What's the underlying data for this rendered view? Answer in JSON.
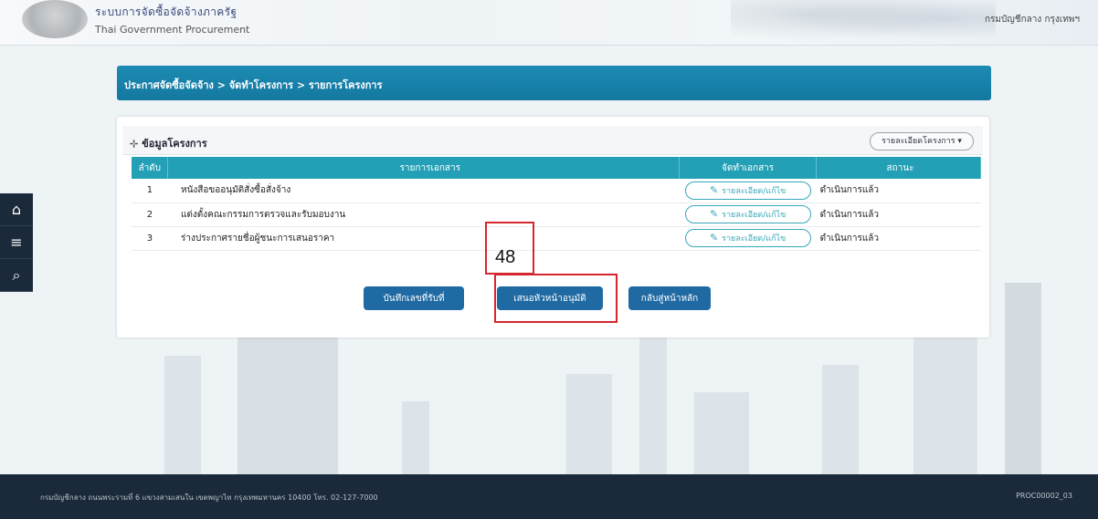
{
  "header": {
    "title": "ระบบการจัดซื้อจัดจ้างภาครัฐ",
    "subtitle": "Thai Government Procurement",
    "agency": "กรมบัญชีกลาง กรุงเทพฯ"
  },
  "sidenav": {
    "home": "⌂",
    "menu": "≡",
    "search": "⌕"
  },
  "breadcrumb": "ประกาศจัดซื้อจัดจ้าง > จัดทำโครงการ > รายการโครงการ",
  "panel": {
    "title": "ข้อมูลโครงการ",
    "dropdown_label": "รายละเอียดโครงการ ▾"
  },
  "table": {
    "headers": [
      "ลำดับ",
      "รายการเอกสาร",
      "จัดทำเอกสาร",
      "สถานะ"
    ],
    "rows": [
      {
        "no": "1",
        "name": "หนังสือขออนุมัติสั่งซื้อสั่งจ้าง",
        "action": "รายละเอียด/แก้ไข",
        "status": "ดำเนินการแล้ว"
      },
      {
        "no": "2",
        "name": "แต่งตั้งคณะกรรมการตรวจและรับมอบงาน",
        "action": "รายละเอียด/แก้ไข",
        "status": "ดำเนินการแล้ว"
      },
      {
        "no": "3",
        "name": "ร่างประกาศรายชื่อผู้ชนะการเสนอราคา",
        "action": "รายละเอียด/แก้ไข",
        "status": "ดำเนินการแล้ว"
      }
    ]
  },
  "buttons": {
    "save": "บันทึกเลขที่รับที่",
    "publish": "เสนอหัวหน้าอนุมัติ",
    "back": "กลับสู่หน้าหลัก"
  },
  "annotation": {
    "label": "48"
  },
  "footer": {
    "text": "กรมบัญชีกลาง ถนนพระรามที่ 6 แขวงสามเสนใน เขตพญาไท กรุงเทพมหานคร 10400 โทร. 02-127-7000",
    "code": "PROC00002_03"
  }
}
